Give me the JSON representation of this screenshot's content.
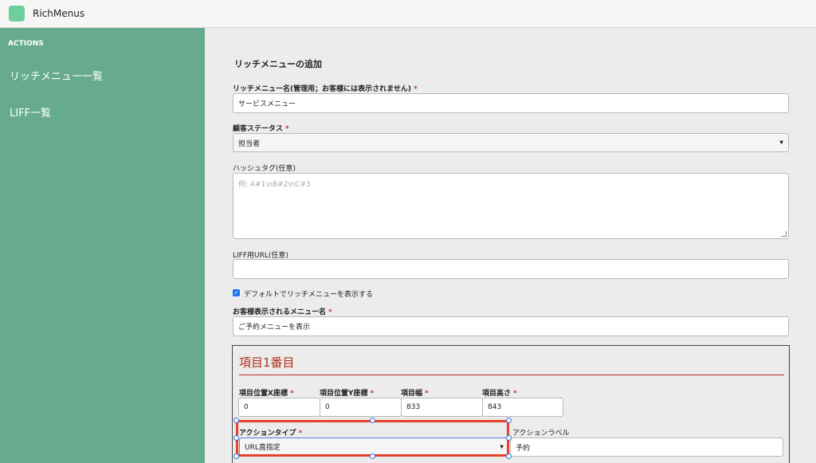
{
  "header": {
    "app_title": "RichMenus"
  },
  "sidebar": {
    "section": "ACTIONS",
    "items": [
      {
        "label": "リッチメニュー一覧"
      },
      {
        "label": "LIFF一覧"
      }
    ]
  },
  "form": {
    "title": "リッチメニューの追加",
    "name_label": "リッチメニュー名(管理用；お客様には表示されません)",
    "name_value": "サービスメニュー",
    "status_label": "顧客ステータス",
    "status_value": "担当者",
    "hashtag_label": "ハッシュタグ(任意)",
    "hashtag_placeholder": "例: A#1\\nB#2\\nC#3",
    "liff_label": "LIFF用URL(任意)",
    "liff_value": "",
    "default_checkbox_label": "デフォルトでリッチメニューを表示する",
    "default_checked": true,
    "display_name_label": "お客様表示されるメニュー名",
    "display_name_value": "ご予約メニューを表示",
    "required_mark": "*"
  },
  "item": {
    "title": "項目1番目",
    "x_label": "項目位置X座標",
    "x_value": "0",
    "y_label": "項目位置Y座標",
    "y_value": "0",
    "width_label": "項目幅",
    "width_value": "833",
    "height_label": "項目高さ",
    "height_value": "843",
    "action_type_label": "アクションタイプ",
    "action_type_value": "URL直指定",
    "action_label_label": "アクションラベル",
    "action_label_value": "予約"
  },
  "colors": {
    "sidebar": "#67ab8f",
    "accent_red": "#b03020",
    "highlight": "#e8402a",
    "handle": "#3b6fd6"
  }
}
